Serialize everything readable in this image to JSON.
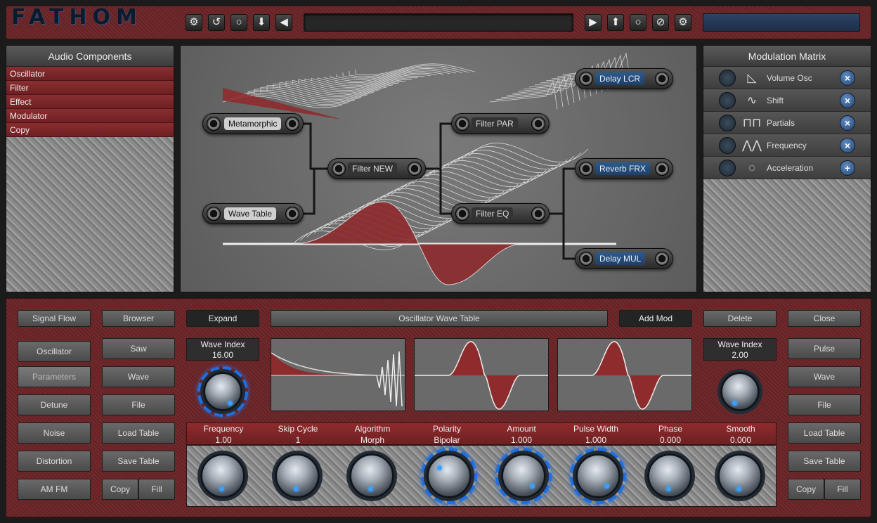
{
  "app": {
    "title": "FATHOM"
  },
  "toolbar": {
    "left_icons": [
      "gear-icon",
      "undo-icon",
      "circle-icon",
      "download-arrow-icon",
      "left-arrow-icon"
    ],
    "right_icons": [
      "play-icon",
      "upload-arrow-icon",
      "circle-icon",
      "disabled-icon",
      "gear-icon"
    ]
  },
  "audio_components": {
    "header": "Audio Components",
    "items": [
      "Oscillator",
      "Filter",
      "Effect",
      "Modulator",
      "Copy"
    ]
  },
  "modulation_matrix": {
    "header": "Modulation Matrix",
    "rows": [
      {
        "label": "Volume Osc",
        "icon": "envelope-icon",
        "action": "remove"
      },
      {
        "label": "Shift",
        "icon": "sine-icon",
        "action": "remove"
      },
      {
        "label": "Partials",
        "icon": "partials-icon",
        "action": "remove"
      },
      {
        "label": "Frequency",
        "icon": "sawtooth-icon",
        "action": "remove"
      },
      {
        "label": "Acceleration",
        "icon": "dial-icon",
        "action": "add"
      }
    ]
  },
  "nodes": {
    "metamorphic": "Metamorphic",
    "wave_table": "Wave Table",
    "filter_new": "Filter NEW",
    "filter_par": "Filter PAR",
    "filter_eq": "Filter EQ",
    "delay_lcr": "Delay LCR",
    "reverb_frx": "Reverb FRX",
    "delay_mul": "Delay MUL"
  },
  "bottom": {
    "left_col1": [
      "Signal Flow",
      "Oscillator",
      "Parameters",
      "Detune",
      "Noise",
      "Distortion",
      "AM FM"
    ],
    "left_col2": [
      "Browser",
      "Saw",
      "Wave",
      "File",
      "Load Table",
      "Save Table"
    ],
    "copy": "Copy",
    "fill": "Fill",
    "expand": "Expand",
    "title": "Oscillator Wave Table",
    "add_mod": "Add Mod",
    "delete": "Delete",
    "close": "Close",
    "right_col": [
      "Pulse",
      "Wave",
      "File",
      "Load Table",
      "Save Table"
    ],
    "wave_index_left": {
      "label": "Wave Index",
      "value": "16.00"
    },
    "wave_index_right": {
      "label": "Wave Index",
      "value": "2.00"
    },
    "params": [
      {
        "label": "Frequency",
        "value": "1.00"
      },
      {
        "label": "Skip Cycle",
        "value": "1"
      },
      {
        "label": "Algorithm",
        "value": "Morph"
      },
      {
        "label": "Polarity",
        "value": "Bipolar"
      },
      {
        "label": "Amount",
        "value": "1.000"
      },
      {
        "label": "Pulse Width",
        "value": "1.000"
      },
      {
        "label": "Phase",
        "value": "0.000"
      },
      {
        "label": "Smooth",
        "value": "0.000"
      }
    ]
  },
  "colors": {
    "leather": "#6a2426",
    "accent": "#1f6fe0",
    "wave_fill": "#8e2b2d"
  }
}
